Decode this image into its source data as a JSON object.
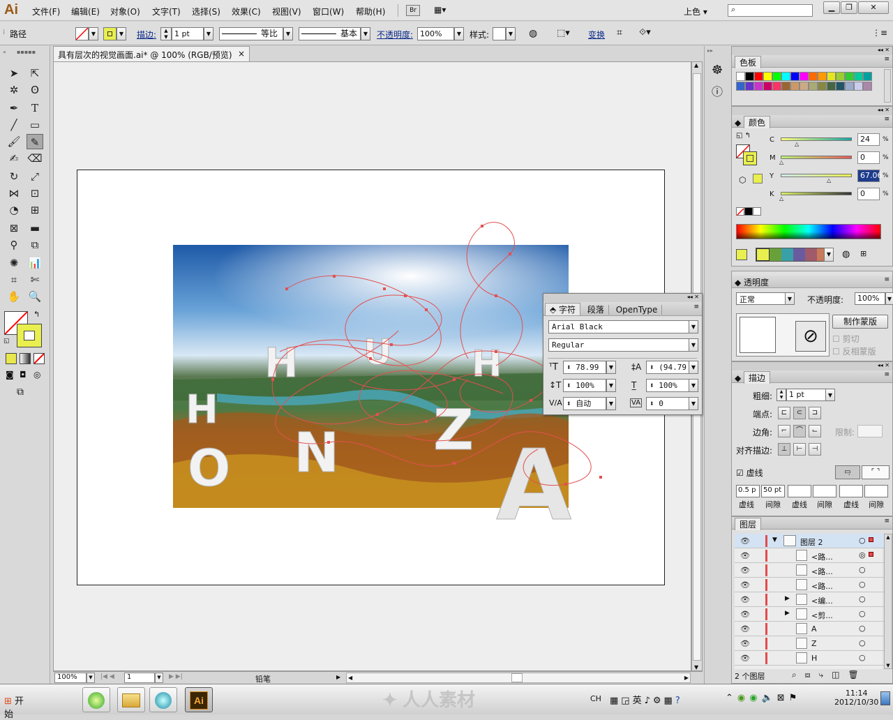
{
  "app": {
    "logo": "Ai",
    "bridge_button": "Br",
    "workspace": "上色"
  },
  "menu": [
    "文件(F)",
    "编辑(E)",
    "对象(O)",
    "文字(T)",
    "选择(S)",
    "效果(C)",
    "视图(V)",
    "窗口(W)",
    "帮助(H)"
  ],
  "control_bar": {
    "selection": "路径",
    "stroke_label": "描边:",
    "stroke_weight": "1 pt",
    "profile_label": "等比",
    "brush_label": "基本",
    "opacity_label": "不透明度:",
    "opacity_value": "100%",
    "style_label": "样式:",
    "transform_label": "变换"
  },
  "document": {
    "tab_title": "具有层次的视觉画面.ai* @ 100% (RGB/预览)",
    "zoom": "100%",
    "page": "1",
    "tool_name": "铅笔"
  },
  "artwork_letters": [
    "H",
    "U",
    "U",
    "H",
    "H",
    "O",
    "N",
    "Z",
    "A"
  ],
  "swatches_panel": {
    "title": "色板",
    "colors": [
      "#ffffff",
      "#000000",
      "#ff0000",
      "#ffff00",
      "#00ff00",
      "#00ffff",
      "#0000ff",
      "#ff00ff",
      "#ff6a00",
      "#ff9900",
      "#e6e61e",
      "#9acd32",
      "#33cc33",
      "#00cc99",
      "#00a0a0",
      "#3366cc",
      "#6633cc",
      "#cc33cc",
      "#cc0066",
      "#ff3366",
      "#996633",
      "#cc9966",
      "#ccaa88",
      "#aaaa77",
      "#888844",
      "#446644",
      "#225566",
      "#99aacc",
      "#ccccee",
      "#aa88aa"
    ]
  },
  "color_panel": {
    "title": "颜色",
    "c_label": "C",
    "m_label": "M",
    "y_label": "Y",
    "k_label": "K",
    "c_value": "24",
    "m_value": "0",
    "y_value": "67.06",
    "k_value": "0",
    "percent": "%",
    "fill_color": "#e8ef4e"
  },
  "character_panel": {
    "tab_char": "字符",
    "tab_para": "段落",
    "tab_opentype": "OpenType",
    "font": "Arial Black",
    "style": "Regular",
    "size": "78.99",
    "leading": "(94.79",
    "hscale": "100%",
    "vscale": "100%",
    "kerning": "自动",
    "tracking": "0"
  },
  "transparency_panel": {
    "title": "透明度",
    "mode": "正常",
    "opacity_label": "不透明度:",
    "opacity_value": "100%",
    "make_mask": "制作蒙版",
    "clip": "剪切",
    "invert": "反相蒙版"
  },
  "stroke_panel": {
    "title": "描边",
    "weight_label": "粗细:",
    "weight_value": "1 pt",
    "cap_label": "端点:",
    "corner_label": "边角:",
    "limit_label": "限制:",
    "align_label": "对齐描边:",
    "dashed_label": "虚线",
    "dash1": "0.5 p",
    "gap1": "50 pt",
    "dash_word": "虚线",
    "gap_word": "间隙"
  },
  "layers_panel": {
    "title": "图层",
    "layer_name": "图层 2",
    "items": [
      "<路...",
      "<路...",
      "<路...",
      "<编...",
      "<剪...",
      "A",
      "Z",
      "H"
    ],
    "count": "2 个图层"
  },
  "taskbar": {
    "start": "开始",
    "ime": "CH",
    "ime_lang": "英",
    "time": "11:14",
    "date": "2012/10/30",
    "watermark": "人人素材"
  }
}
